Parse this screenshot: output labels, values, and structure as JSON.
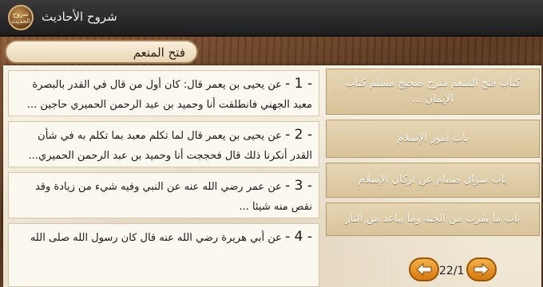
{
  "app": {
    "title": "شروح الأحاديث",
    "logo_text": "شروح الحديث"
  },
  "section": {
    "title": "فتح المنعم"
  },
  "hadiths": [
    {
      "number": "- 1 -",
      "text": "عن يحيى بن يعمر قال: كان أول من قال في القدر بالبصرة معبد الجهني فانطلقت أنا وحميد بن عبد الرحمن الحميري حاجين ..."
    },
    {
      "number": "- 2 -",
      "text": "عن يحيى بن يعمر قال لما تكلم معبد بما تكلم به في شأن القدر أنكرنا ذلك قال فحججت أنا وحميد بن عبد الرحمن الحميري..."
    },
    {
      "number": "- 3 -",
      "text": "عن عمر رضي الله عنه عن النبي وفيه شيء من زيادة وقد نقص منه شيئا ..."
    },
    {
      "number": "- 4 -",
      "text": "عن أبي هريرة رضي الله عنه قال كان رسول الله صلى الله"
    }
  ],
  "chapters": [
    {
      "label": "كتاب فتح المنعم شرح صحيح مسلم كتاب الإيمان ..."
    },
    {
      "label": "باب أمور الإسلام"
    },
    {
      "label": "باب سؤال ضمام عن أركان الإسلام"
    },
    {
      "label": "باب ما يقرب من الجنة وما يباعد من النار"
    }
  ],
  "pager": {
    "counter": "22/1",
    "prev_icon": "arrow-left-icon",
    "next_icon": "arrow-right-icon",
    "accent_color": "#e8961f"
  },
  "colors": {
    "titlebar": "#2a2a2a",
    "wood": "#6b4428",
    "paper": "#f3ecdc",
    "chapter": "#ddc8a0"
  }
}
